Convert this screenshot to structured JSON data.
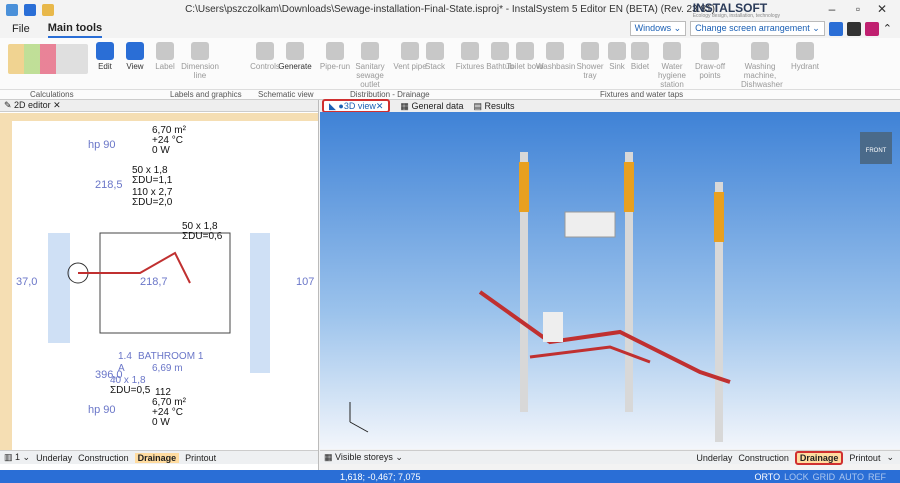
{
  "window": {
    "title": "C:\\Users\\pszczolkam\\Downloads\\Sewage-installation-Final-State.isproj* - InstalSystem 5 Editor EN (BETA) (Rev. 23.81)",
    "brand": "INSTALSOFT",
    "brand_sub": "Ecology design, installation, technology"
  },
  "menu": {
    "file": "File",
    "main_tools": "Main tools",
    "windows": "Windows",
    "arrangement": "Change screen arrangement"
  },
  "ribbon": {
    "buttons": [
      "Edit",
      "View",
      "Label",
      "Dimension line",
      "Controls",
      "Generate",
      "Pipe-run",
      "Sanitary sewage outlet",
      "Vent pipe",
      "Stack",
      "Fixtures",
      "Bathtub",
      "Toilet bowl",
      "Washbasin",
      "Shower tray",
      "Sink",
      "Bidet",
      "Water hygiene station",
      "Draw-off points",
      "Washing machine, Dishwasher",
      "Hydrant"
    ],
    "groups": [
      "Calculations",
      "Labels and graphics",
      "Schematic view",
      "Distribution - Drainage",
      "Fixtures and water taps"
    ]
  },
  "left_panel": {
    "tab": "2D editor",
    "labels": [
      "6,70 m²",
      "+24 °C",
      "0 W",
      "50 x 1,8",
      "ΣDU=1,1",
      "110 x 2,7",
      "ΣDU=2,0",
      "50 x 1,8",
      "ΣDU=0,6",
      "218,5",
      "218,7",
      "37,0",
      "107",
      "1.4",
      "BATHROOM 1",
      "A",
      "6,69 m",
      "40 x 1,8",
      "ΣDU=0,5",
      "112",
      "6,70 m²",
      "+24 °C",
      "0 W",
      "hp 90",
      "hp 90",
      "396,0"
    ],
    "bottom": {
      "floor": "1",
      "underlay": "Underlay",
      "construction": "Construction",
      "drainage": "Drainage",
      "printout": "Printout"
    }
  },
  "right_panel": {
    "tabs": [
      "3D view",
      "General data",
      "Results"
    ],
    "cube_label": "FRONT",
    "bottom": {
      "visible_storeys": "Visible storeys",
      "underlay": "Underlay",
      "construction": "Construction",
      "drainage": "Drainage",
      "printout": "Printout"
    }
  },
  "status": {
    "coords": "1,618; -0,467; 7,075",
    "flags": [
      "ORTO",
      "LOCK",
      "GRID",
      "AUTO",
      "REF"
    ]
  }
}
